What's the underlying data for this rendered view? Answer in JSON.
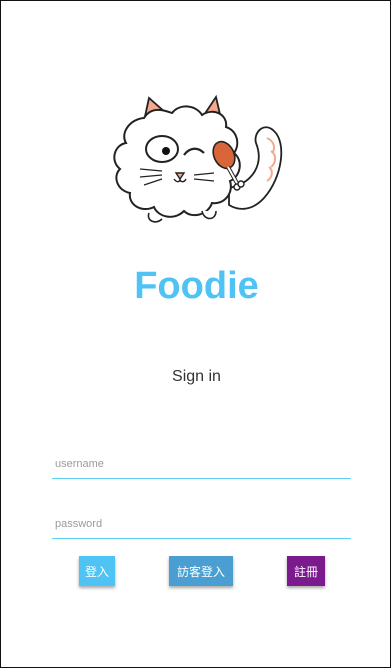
{
  "app": {
    "name": "Foodie"
  },
  "screen": {
    "subtitle": "Sign in"
  },
  "form": {
    "username_placeholder": "username",
    "username_value": "",
    "password_placeholder": "password",
    "password_value": ""
  },
  "buttons": {
    "login_label": "登入",
    "guest_login_label": "訪客登入",
    "register_label": "註冊"
  },
  "colors": {
    "brand": "#4ec3f4",
    "login_button": "#4ec3f4",
    "guest_button": "#4a9ed2",
    "register_button": "#7b1a8c",
    "field_underline": "#5fd0f3"
  },
  "icons": {
    "logo": "cat-holding-drumstick-icon"
  }
}
